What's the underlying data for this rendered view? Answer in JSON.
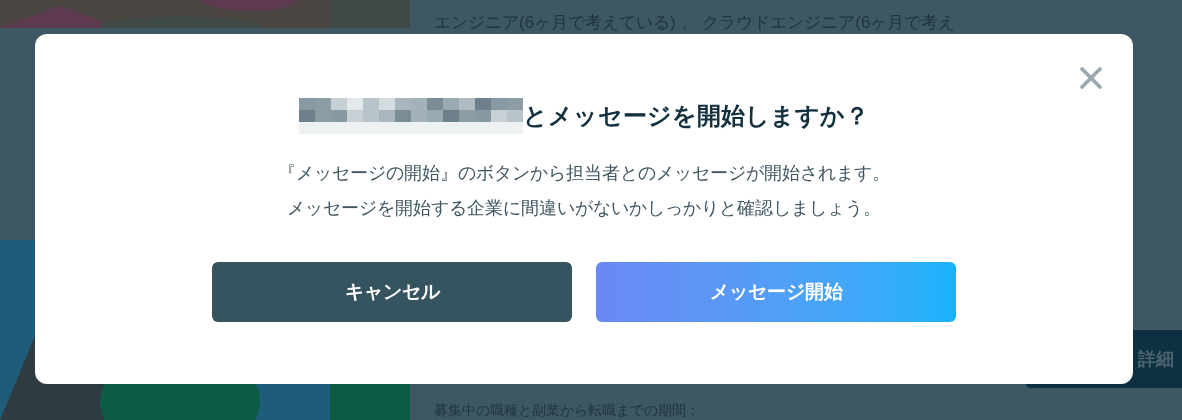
{
  "page": {
    "top_text": "エンジニア(6ヶ月で考えている) 、 クラウドエンジニア(6ヶ月で考え",
    "details_button": "詳細",
    "bottom_text": "募集中の職種と副業から転職までの期間："
  },
  "dialog": {
    "title": "とメッセージを開始しますか？",
    "body": [
      "『メッセージの開始』のボタンから担当者とのメッセージが開始されます。",
      "メッセージを開始する企業に間違いがないかしっかりと確認しましょう。"
    ],
    "cancel_button": "キャンセル",
    "start_button": "メッセージ開始"
  }
}
